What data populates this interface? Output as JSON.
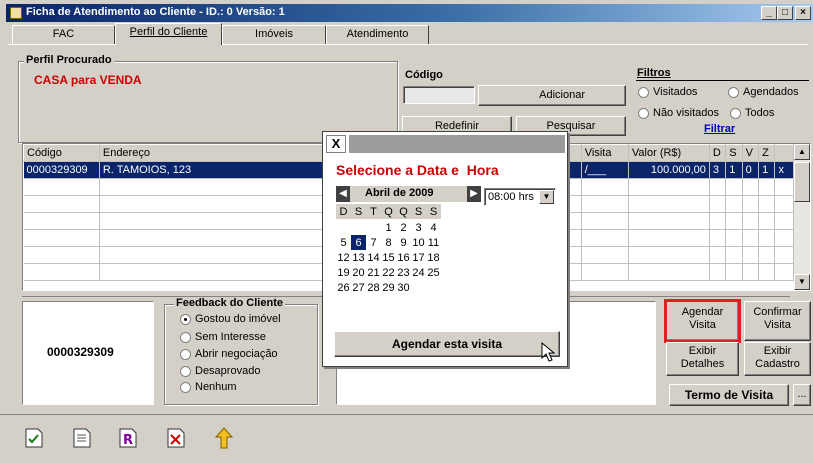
{
  "window": {
    "title": "Ficha de Atendimento ao Cliente - ID.: 0 Versão: 1",
    "controls": [
      "_",
      "□",
      "×"
    ]
  },
  "tabs": [
    {
      "label": "FAC"
    },
    {
      "label": "Perfil do Cliente"
    },
    {
      "label": "Imóveis"
    },
    {
      "label": "Atendimento"
    }
  ],
  "perfil": {
    "group_label": "Perfil Procurado",
    "value": "CASA para VENDA"
  },
  "codigo": {
    "label": "Código",
    "input_value": "",
    "add_button": "Adicionar",
    "redefine_button": "Redefinir",
    "search_button": "Pesquisar"
  },
  "filtros": {
    "label": "Filtros",
    "options": [
      "Visitados",
      "Agendados",
      "Não visitados",
      "Todos"
    ],
    "filter_link": "Filtrar"
  },
  "grid": {
    "headers": [
      "Código",
      "Endereço",
      "Visita",
      "Valor (R$)",
      "D",
      "S",
      "V",
      "Z"
    ],
    "selected_row": {
      "codigo": "0000329309",
      "endereco": "R. TAMOIOS, 123",
      "visita": "/___",
      "valor": "100.000,00",
      "d": "3",
      "s": "1",
      "v": "0",
      "z": "1",
      "extra": "x"
    }
  },
  "codigo_box": "0000329309",
  "feedback": {
    "label": "Feedback do Cliente",
    "options": [
      "Gostou do imóvel",
      "Sem Interesse",
      "Abrir negociação",
      "Desaprovado",
      "Nenhum"
    ],
    "selected": 0
  },
  "actions": {
    "agendar": [
      "Agendar",
      "Visita"
    ],
    "confirmar": [
      "Confirmar",
      "Visita"
    ],
    "exibir_detalhes": [
      "Exibir",
      "Detalhes"
    ],
    "exibir_cadastro": [
      "Exibir",
      "Cadastro"
    ],
    "termo": "Termo de Visita",
    "more": "..."
  },
  "popup": {
    "close": "X",
    "heading": "Selecione a Data e  Hora",
    "month": "Abril de 2009",
    "time": "08:00 hrs",
    "weekdays": [
      "D",
      "S",
      "T",
      "Q",
      "Q",
      "S",
      "S"
    ],
    "weeks": [
      [
        "",
        "",
        "",
        "1",
        "2",
        "3",
        "4"
      ],
      [
        "5",
        "6",
        "7",
        "8",
        "9",
        "10",
        "11"
      ],
      [
        "12",
        "13",
        "14",
        "15",
        "16",
        "17",
        "18"
      ],
      [
        "19",
        "20",
        "21",
        "22",
        "23",
        "24",
        "25"
      ],
      [
        "26",
        "27",
        "28",
        "29",
        "30",
        "",
        ""
      ]
    ],
    "selected_day": "6",
    "schedule_button": "Agendar esta visita"
  },
  "colors": {
    "accent_red": "#cc0000",
    "selection": "#0a246a",
    "link_blue": "#0000cc",
    "highlight_border": "#e02020"
  },
  "toolbar_icons": [
    "check-document-icon",
    "document-icon",
    "document-r-icon",
    "document-x-icon",
    "arrow-up-icon"
  ]
}
